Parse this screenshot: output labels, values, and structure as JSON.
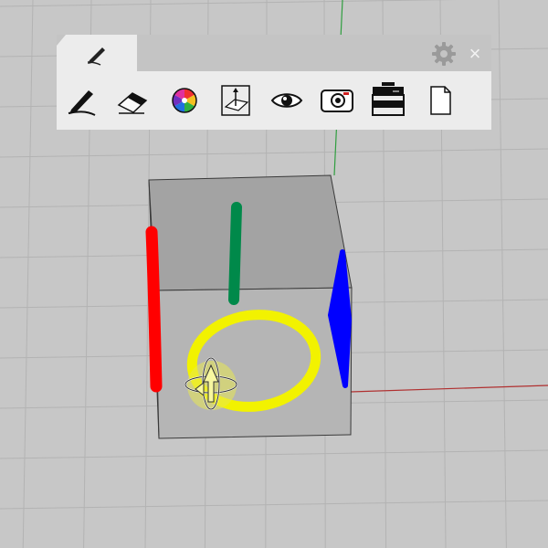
{
  "toolbar": {
    "active_tab_icon": "pen-icon",
    "header_icons": [
      "gear-icon",
      "close-icon"
    ],
    "close_glyph": "×",
    "tools": [
      {
        "name": "pen-tool",
        "icon": "pen-icon"
      },
      {
        "name": "eraser-tool",
        "icon": "eraser-icon"
      },
      {
        "name": "color-picker",
        "icon": "color-wheel-icon"
      },
      {
        "name": "plane-tool",
        "icon": "drawing-plane-icon"
      },
      {
        "name": "visibility-toggle",
        "icon": "eye-icon"
      },
      {
        "name": "capture-tool",
        "icon": "camera-icon"
      },
      {
        "name": "print-tool",
        "icon": "printer-icon"
      },
      {
        "name": "new-page-tool",
        "icon": "page-icon"
      }
    ]
  },
  "scene": {
    "background": "#c7c7c7",
    "grid_color": "#b3b3b3",
    "axis_colors": {
      "x": "#b03030",
      "y": "#2f9e3f"
    },
    "cube_faces": {
      "top": "#a3a3a3",
      "front": "#b5b5b5"
    },
    "strokes": [
      {
        "name": "red-stroke",
        "color": "#ff0000"
      },
      {
        "name": "green-stroke",
        "color": "#00894a"
      },
      {
        "name": "blue-stroke",
        "color": "#0000ff"
      },
      {
        "name": "yellow-stroke",
        "color": "#f2f200"
      }
    ]
  }
}
